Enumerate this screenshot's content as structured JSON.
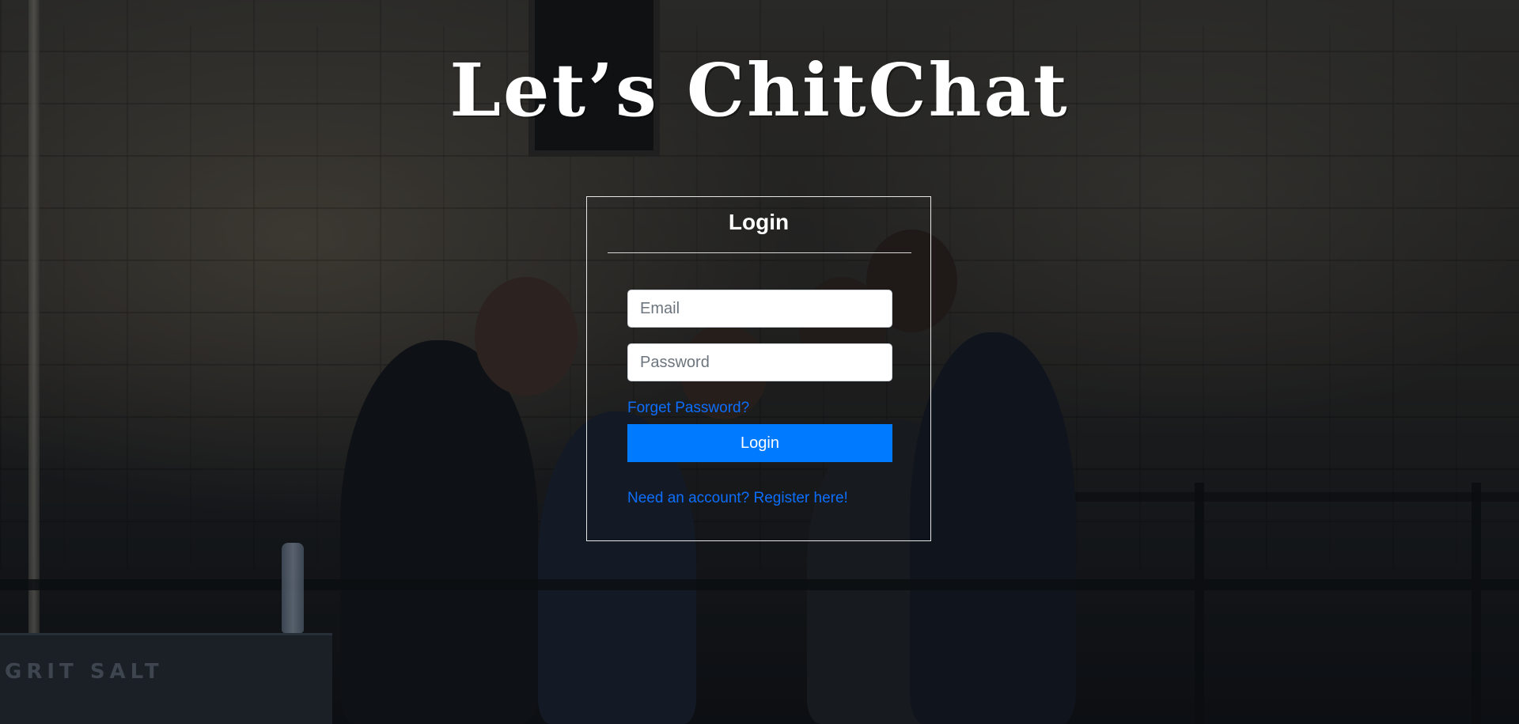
{
  "app": {
    "brand_title": "Let’s ChitChat"
  },
  "login_card": {
    "heading": "Login",
    "email_placeholder": "Email",
    "password_placeholder": "Password",
    "forgot_link": "Forget Password?",
    "submit_label": "Login",
    "register_link": "Need an account? Register here!"
  },
  "background": {
    "sign_text": "GRIT SALT"
  },
  "colors": {
    "primary_button": "#007bff",
    "link": "#0d6efd",
    "text_on_dark": "#ffffff"
  }
}
